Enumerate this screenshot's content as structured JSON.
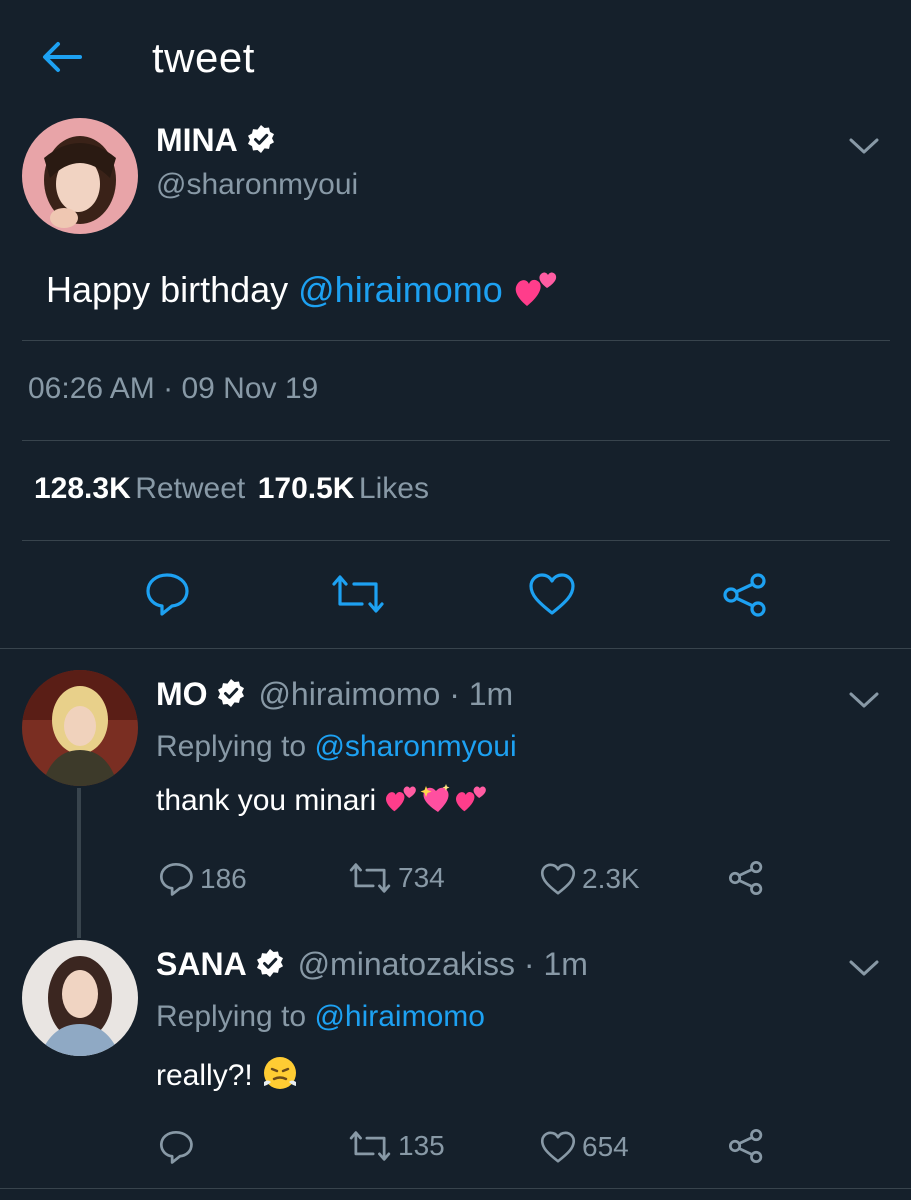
{
  "header": {
    "title": "tweet"
  },
  "main_tweet": {
    "name": "MINA",
    "handle": "@sharonmyoui",
    "text": "Happy birthday ",
    "mention": "@hiraimomo",
    "time": "06:26 AM",
    "separator": "·",
    "date": "09 Nov 19",
    "retweet_count": "128.3K",
    "retweet_label": "Retweet",
    "like_count": "170.5K",
    "like_label": "Likes"
  },
  "replies": [
    {
      "name": "MO",
      "handle": "@hiraimomo",
      "time": "· 1m",
      "replying_label": "Replying to ",
      "replying_to": "@sharonmyoui",
      "text": "thank you minari",
      "reply_count": "186",
      "retweet_count": "734",
      "like_count": "2.3K"
    },
    {
      "name": "SANA",
      "handle": "@minatozakiss",
      "time": "· 1m",
      "replying_label": "Replying to ",
      "replying_to": "@hiraimomo",
      "text": "really?!",
      "reply_count": "",
      "retweet_count": "135",
      "like_count": "654"
    }
  ],
  "colors": {
    "background": "#15202b",
    "accent": "#1da1f2",
    "muted": "#8899a6",
    "divider": "#38444d"
  },
  "icons": [
    "back-arrow-icon",
    "verified-badge-icon",
    "chevron-down-icon",
    "reply-icon",
    "retweet-icon",
    "like-icon",
    "share-icon",
    "two-hearts-emoji",
    "sparkling-heart-emoji",
    "steam-face-emoji"
  ]
}
